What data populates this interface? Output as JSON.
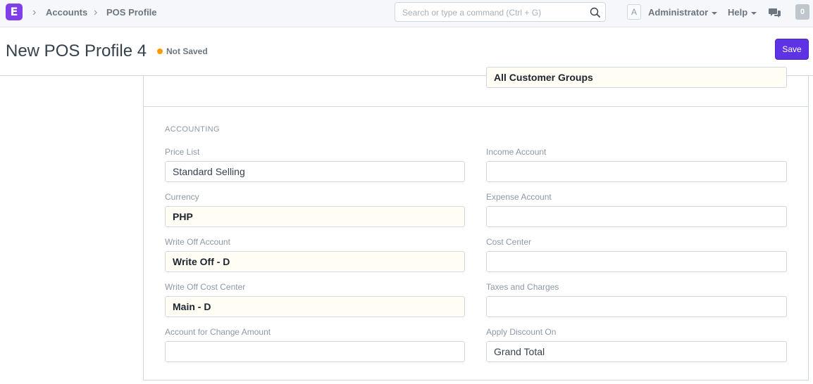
{
  "app": {
    "logo_letter": "E"
  },
  "breadcrumb": [
    "Accounts",
    "POS Profile"
  ],
  "search": {
    "placeholder": "Search or type a command (Ctrl + G)",
    "value": ""
  },
  "navbar": {
    "avatar_letter": "A",
    "user": "Administrator",
    "help": "Help",
    "notification_count": "0"
  },
  "page": {
    "title": "New POS Profile 4",
    "status": "Not Saved",
    "save_label": "Save"
  },
  "form": {
    "customer_group_value": "All Customer Groups",
    "section_title": "ACCOUNTING",
    "fields_left": [
      {
        "label": "Price List",
        "value": "Standard Selling"
      },
      {
        "label": "Currency",
        "value": "PHP"
      },
      {
        "label": "Write Off Account",
        "value": "Write Off - D"
      },
      {
        "label": "Write Off Cost Center",
        "value": "Main - D"
      },
      {
        "label": "Account for Change Amount",
        "value": ""
      }
    ],
    "fields_right": [
      {
        "label": "Income Account",
        "value": ""
      },
      {
        "label": "Expense Account",
        "value": ""
      },
      {
        "label": "Cost Center",
        "value": ""
      },
      {
        "label": "Taxes and Charges",
        "value": ""
      },
      {
        "label": "Apply Discount On",
        "value": "Grand Total"
      }
    ]
  },
  "colors": {
    "brand": "#7f3ee7",
    "primary_button": "#5e33e4",
    "indicator_orange": "#ff9a00"
  }
}
